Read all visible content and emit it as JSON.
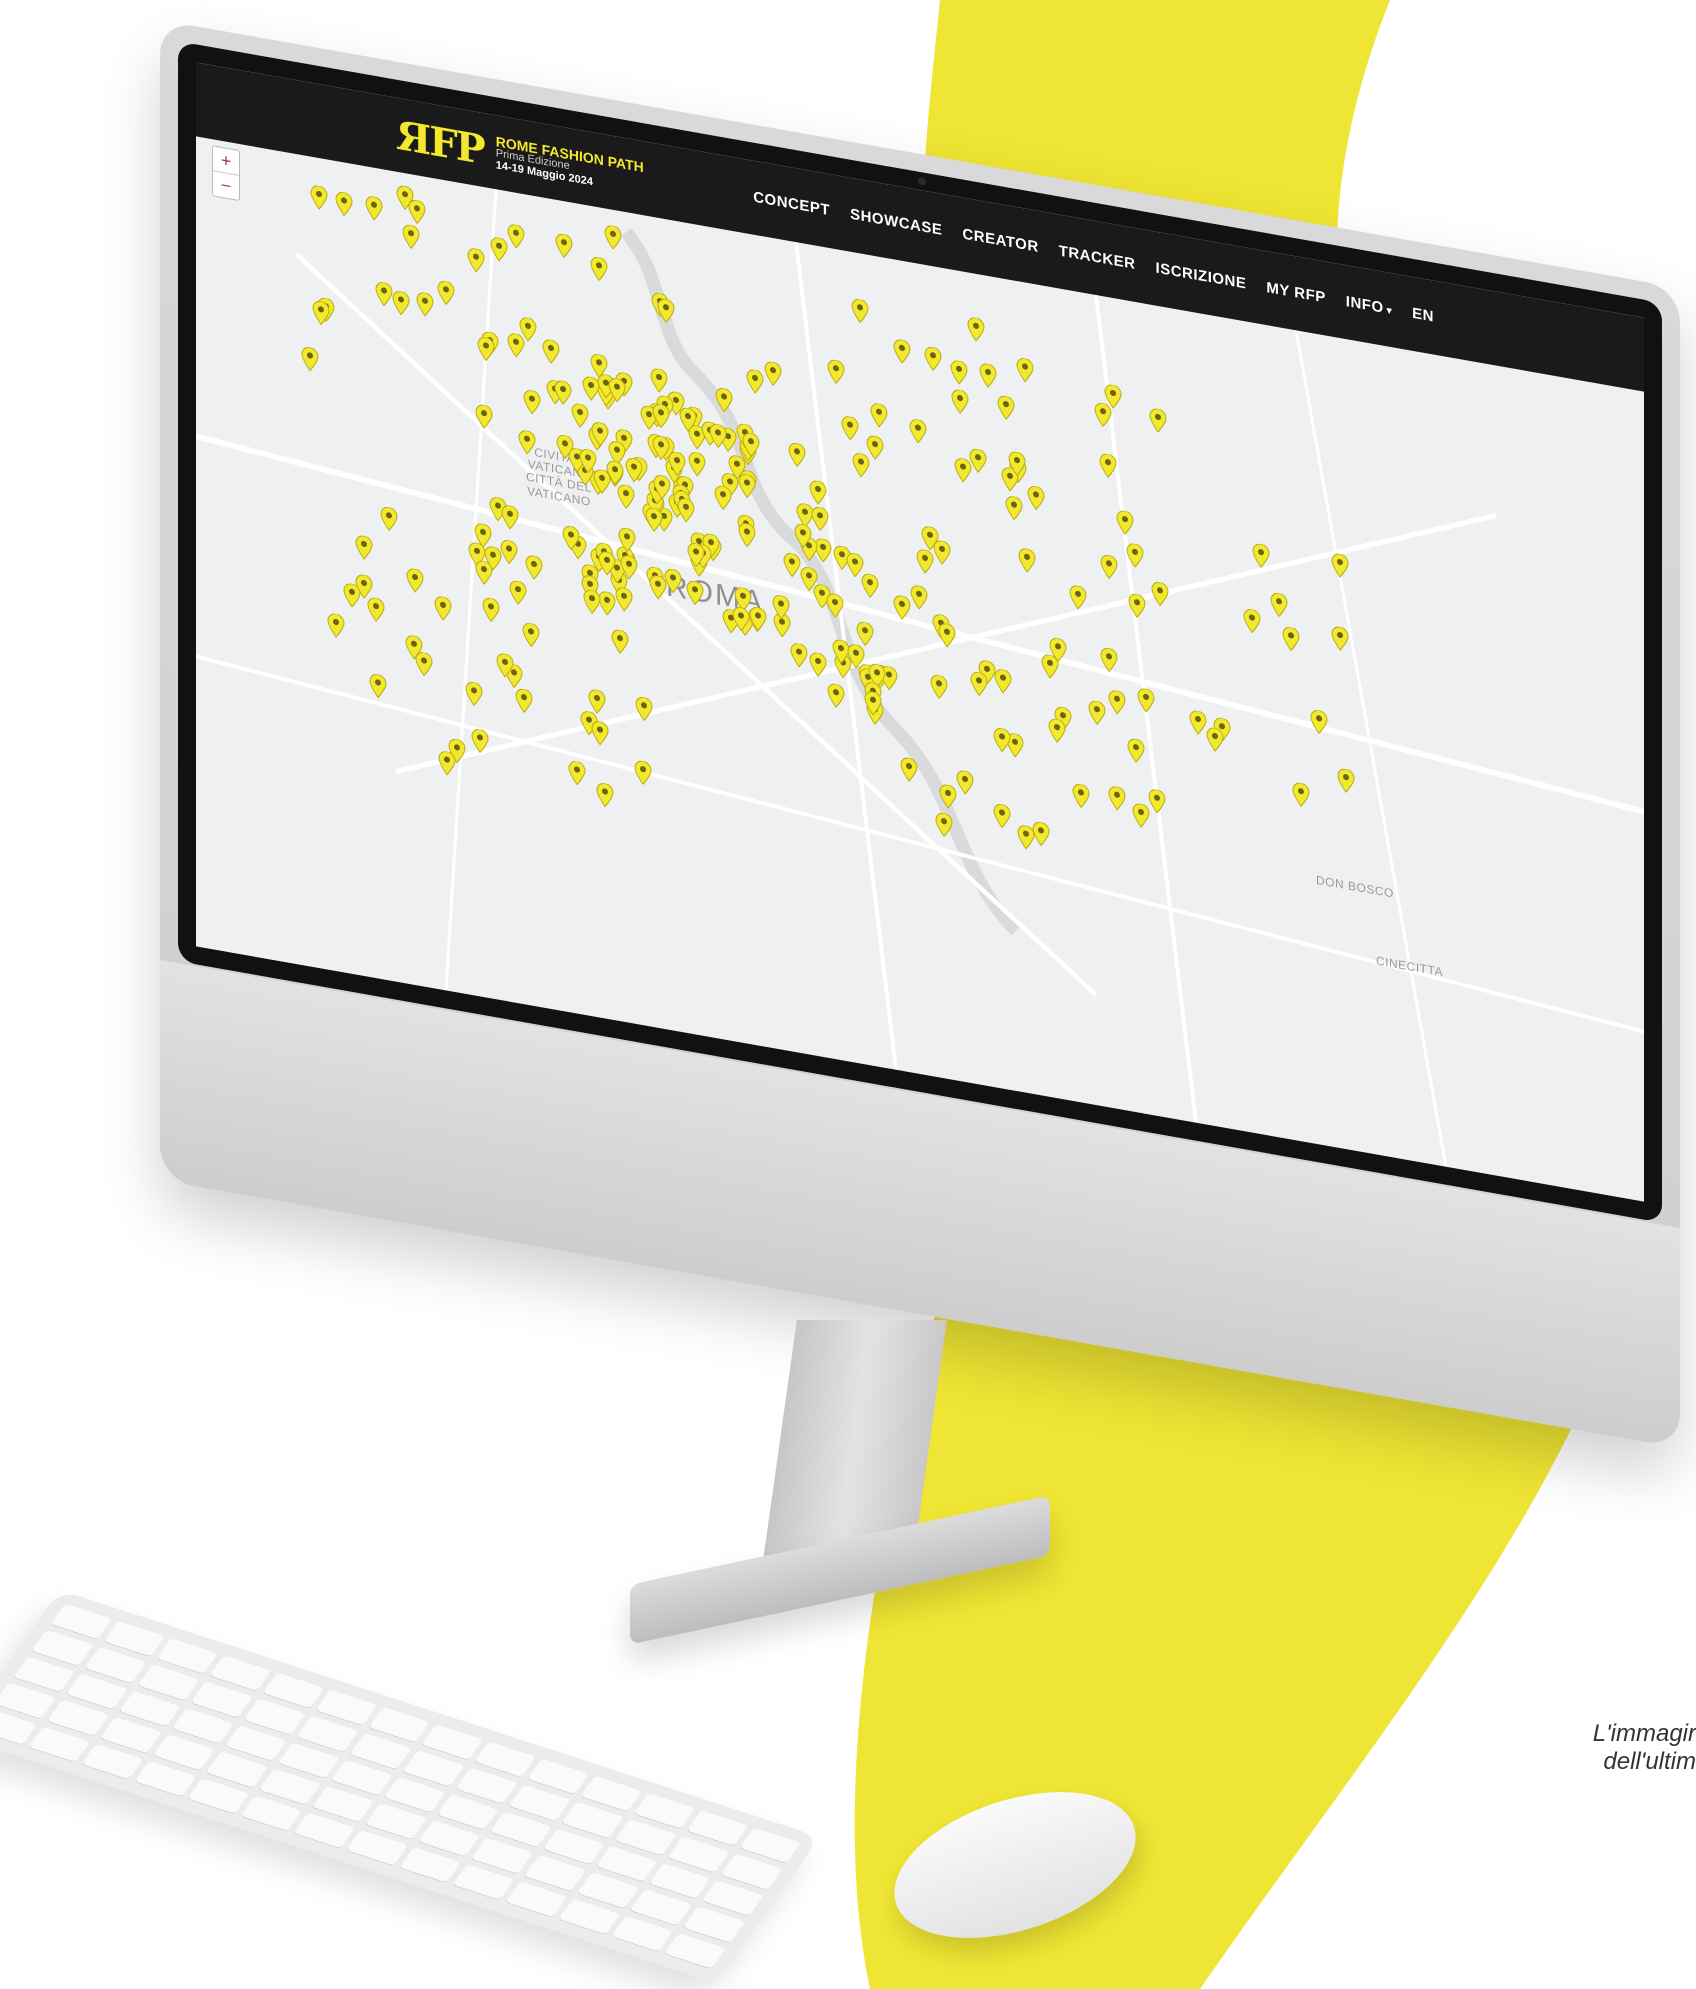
{
  "logo": {
    "mark": "ЯFP",
    "title": "ROME FASHION PATH",
    "subtitle": "Prima Edizione",
    "dates": "14-19 Maggio 2024"
  },
  "nav": {
    "items": [
      "CONCEPT",
      "SHOWCASE",
      "CREATOR",
      "TRACKER",
      "ISCRIZIONE",
      "MY RFP",
      "INFO",
      "EN"
    ]
  },
  "zoom": {
    "in": "+",
    "out": "−"
  },
  "map_labels": {
    "vatican": "CIVITAS\nVATICANA\nCITTÀ DEL\nVATICANO",
    "city": "ROMA",
    "don_bosco": "DON BOSCO",
    "cinecitta": "CINECITTA"
  },
  "caption": {
    "line1": "L'immagir",
    "line2": "dell'ultim"
  },
  "colors": {
    "accent_yellow": "#f2e82e",
    "topbar": "#1a1a1a",
    "map_background": "#eef0f1",
    "zoom_symbol": "#a1307a"
  },
  "icons": {
    "map_pin": "map-pin-icon",
    "zoom_in": "plus-icon",
    "zoom_out": "minus-icon",
    "dropdown": "caret-down-icon"
  }
}
